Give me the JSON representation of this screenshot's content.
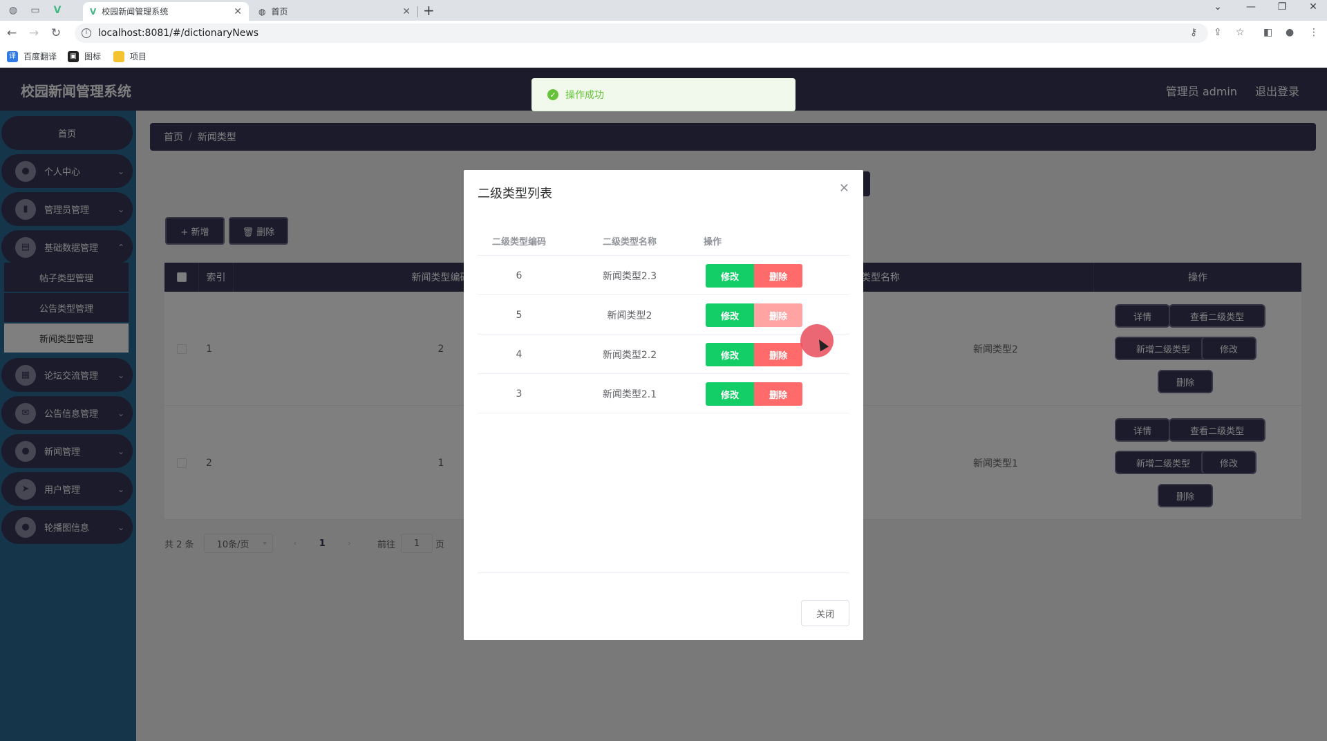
{
  "browser": {
    "tabs": [
      {
        "label": "校园新闻管理系统",
        "active": true
      },
      {
        "label": "首页",
        "active": false
      }
    ],
    "url": "localhost:8081/#/dictionaryNews",
    "bookmarks": [
      "百度翻译",
      "图标",
      "项目"
    ]
  },
  "app": {
    "title": "校园新闻管理系统",
    "user_label": "管理员 admin",
    "logout_label": "退出登录",
    "toast": "操作成功",
    "colors": {
      "primary": "#363658",
      "sidebar": "#2a6b96",
      "success": "#13ce66",
      "danger": "#ff6b6b"
    }
  },
  "sidebar": {
    "items": [
      {
        "label": "首页",
        "icon": "home-icon"
      },
      {
        "label": "个人中心",
        "icon": "user-icon"
      },
      {
        "label": "管理员管理",
        "icon": "admin-icon"
      },
      {
        "label": "基础数据管理",
        "icon": "clipboard-icon"
      },
      {
        "label": "论坛交流管理",
        "icon": "grid-icon"
      },
      {
        "label": "公告信息管理",
        "icon": "bullhorn-icon"
      },
      {
        "label": "新闻管理",
        "icon": "location-icon"
      },
      {
        "label": "用户管理",
        "icon": "send-icon"
      },
      {
        "label": "轮播图信息",
        "icon": "user-icon"
      }
    ],
    "submenu": [
      "帖子类型管理",
      "公告类型管理",
      "新闻类型管理"
    ]
  },
  "main": {
    "breadcrumb": [
      "首页",
      "新闻类型"
    ],
    "add_label": "+ 新增",
    "delete_label": "🗑 删除",
    "table": {
      "headers": [
        "索引",
        "新闻类型编码",
        "新闻类型名称",
        "操作"
      ],
      "rows": [
        {
          "index": "1",
          "code": "2",
          "name": "新闻类型2"
        },
        {
          "index": "2",
          "code": "1",
          "name": "新闻类型1"
        }
      ],
      "row_actions": [
        "详情",
        "查看二级类型",
        "新增二级类型",
        "修改",
        "删除"
      ]
    },
    "pager": {
      "total": "共 2 条",
      "page_size": "10条/页",
      "current": "1",
      "goto_prefix": "前往",
      "goto_value": "1",
      "goto_suffix": "页"
    }
  },
  "dialog": {
    "title": "二级类型列表",
    "headers": [
      "二级类型编码",
      "二级类型名称",
      "操作"
    ],
    "rows": [
      {
        "code": "6",
        "name": "新闻类型2.3"
      },
      {
        "code": "5",
        "name": "新闻类型2"
      },
      {
        "code": "4",
        "name": "新闻类型2.2"
      },
      {
        "code": "3",
        "name": "新闻类型2.1"
      }
    ],
    "edit_label": "修改",
    "delete_label": "删除",
    "close_label": "关闭"
  }
}
